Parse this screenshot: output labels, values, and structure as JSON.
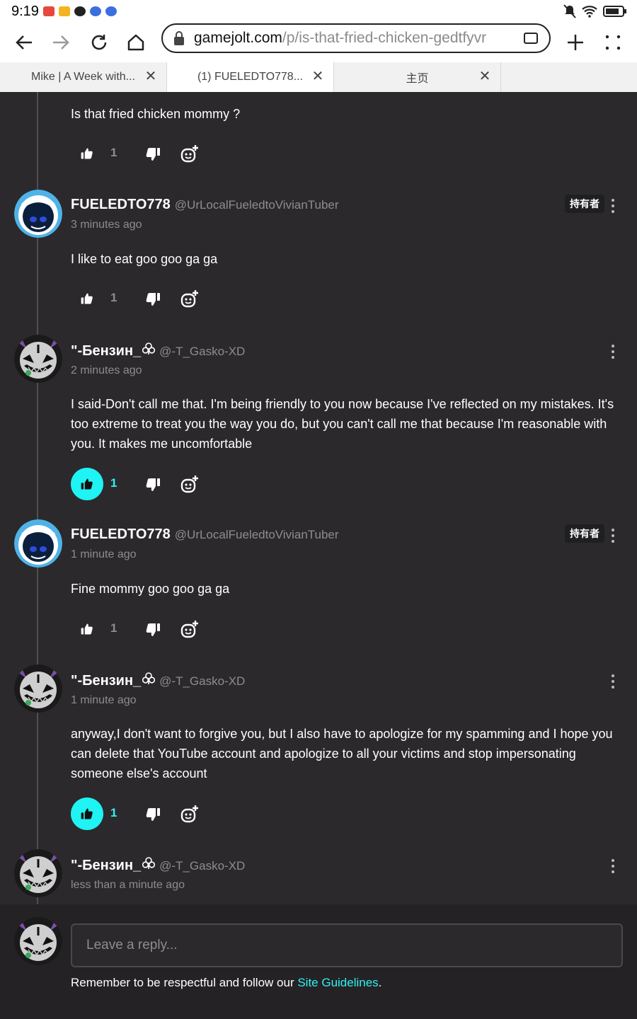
{
  "status_bar": {
    "time": "9:19"
  },
  "browser": {
    "url_host": "gamejolt.com",
    "url_path": "/p/is-that-fried-chicken-gedtfyvr",
    "tabs": [
      {
        "title": "Mike | A Week with..."
      },
      {
        "title": "(1) FUELEDTO778..."
      },
      {
        "title": "主页"
      }
    ]
  },
  "thread": {
    "top_comment": {
      "text": "Is that fried chicken mommy ?",
      "likes": "1"
    },
    "comments": [
      {
        "name": "FUELEDTO778",
        "handle": "@UrLocalFueledtoVivianTuber",
        "time": "3 minutes ago",
        "owner_badge": "持有者",
        "text": "I like to eat goo goo ga ga",
        "likes": "1",
        "liked": false
      },
      {
        "name": "\"-Бензин_",
        "handle": "@-T_Gasko-XD",
        "time": "2 minutes ago",
        "text": "I said-Don't call me that. I'm being friendly to you now because I've reflected on my mistakes. It's too extreme to treat you the way you do, but you can't call me that because I'm reasonable with you. It makes me uncomfortable",
        "likes": "1",
        "liked": true
      },
      {
        "name": "FUELEDTO778",
        "handle": "@UrLocalFueledtoVivianTuber",
        "time": "1 minute ago",
        "owner_badge": "持有者",
        "text": "Fine mommy goo goo ga ga",
        "likes": "1",
        "liked": false
      },
      {
        "name": "\"-Бензин_",
        "handle": "@-T_Gasko-XD",
        "time": "1 minute ago",
        "text": "anyway,I don't want to forgive you, but I also have to apologize for my spamming and I hope you can delete that YouTube account and apologize to all your victims and stop impersonating someone else's account",
        "likes": "1",
        "liked": true
      },
      {
        "name": "\"-Бензин_",
        "handle": "@-T_Gasko-XD",
        "time": "less than a minute ago"
      }
    ]
  },
  "reply": {
    "placeholder": "Leave a reply...",
    "guideline_prefix": "Remember to be respectful and follow our ",
    "guideline_link": "Site Guidelines",
    "guideline_suffix": "."
  },
  "colors": {
    "accent": "#2ef2f2",
    "background": "#2b292c",
    "muted": "#8f8c90"
  }
}
